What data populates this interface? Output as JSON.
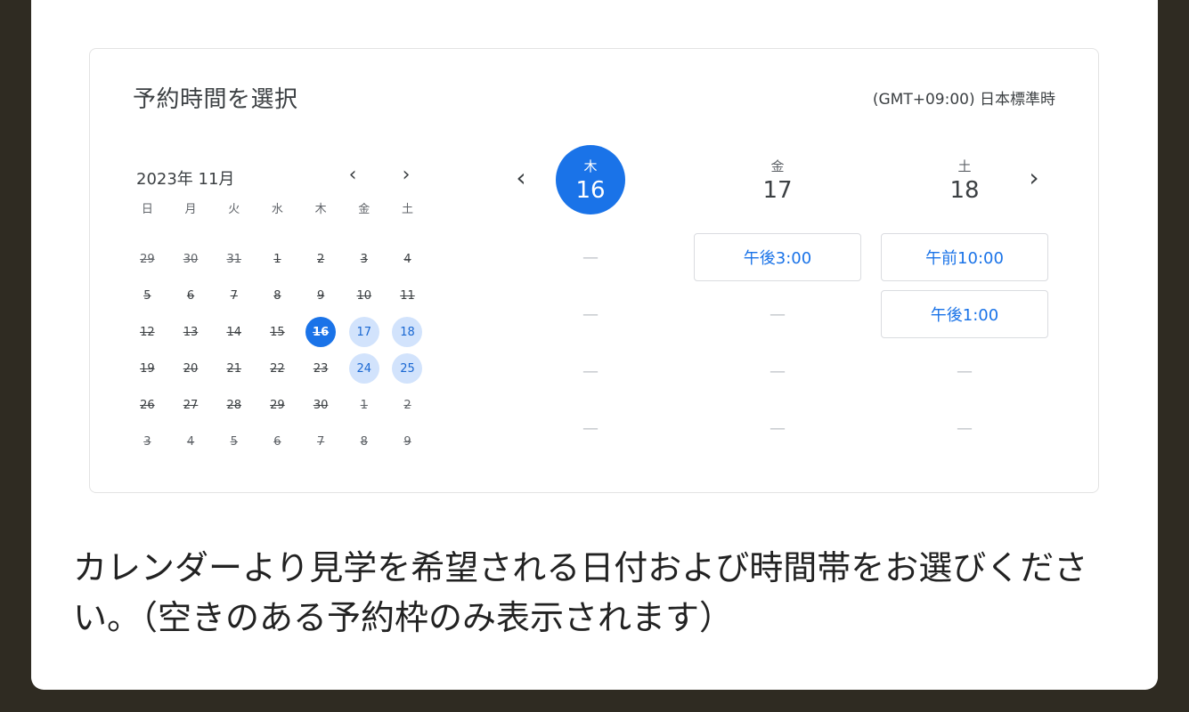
{
  "panel": {
    "title": "予約時間を選択",
    "timezone": "(GMT+09:00) 日本標準時"
  },
  "mini_calendar": {
    "month_label": "2023年 11月",
    "prev_icon": "‹",
    "next_icon": "›",
    "weekdays": [
      "日",
      "月",
      "火",
      "水",
      "木",
      "金",
      "土"
    ],
    "weeks": [
      [
        "29",
        "30",
        "31",
        "1",
        "2",
        "3",
        "4"
      ],
      [
        "5",
        "6",
        "7",
        "8",
        "9",
        "10",
        "11"
      ],
      [
        "12",
        "13",
        "14",
        "15",
        "16",
        "17",
        "18"
      ],
      [
        "19",
        "20",
        "21",
        "22",
        "23",
        "24",
        "25"
      ],
      [
        "26",
        "27",
        "28",
        "29",
        "30",
        "1",
        "2"
      ],
      [
        "3",
        "4",
        "5",
        "6",
        "7",
        "8",
        "9"
      ]
    ],
    "selected": "16",
    "available": [
      "17",
      "18",
      "24",
      "25"
    ]
  },
  "week_view": {
    "prev_icon": "‹",
    "next_icon": "›",
    "columns": [
      {
        "weekday": "木",
        "date": "16",
        "active": true,
        "slots": [
          "—",
          "—",
          "—",
          "—"
        ]
      },
      {
        "weekday": "金",
        "date": "17",
        "active": false,
        "slots": [
          "午後3:00",
          "—",
          "—",
          "—"
        ]
      },
      {
        "weekday": "土",
        "date": "18",
        "active": false,
        "slots": [
          "午前10:00",
          "午後1:00",
          "—",
          "—"
        ]
      }
    ]
  },
  "caption": "カレンダーより見学を希望される日付および時間帯をお選びください。（空きのある予約枠のみ表示されます）",
  "colors": {
    "accent": "#1a73e8",
    "available_bg": "#d2e3fc",
    "outer_bg": "#2f2b22"
  }
}
